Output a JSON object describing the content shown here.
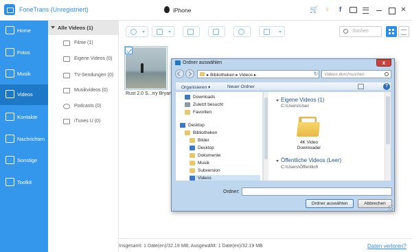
{
  "app": {
    "title": "FoneTrans (Unregistriert)",
    "device": "iPhone",
    "accent": "#2c8ee6"
  },
  "sidebar": {
    "items": [
      {
        "label": "Home",
        "icon": "home-icon"
      },
      {
        "label": "Fotos",
        "icon": "photos-icon"
      },
      {
        "label": "Musik",
        "icon": "music-icon"
      },
      {
        "label": "Videos",
        "icon": "videos-icon",
        "active": true
      },
      {
        "label": "Kontakte",
        "icon": "contacts-icon"
      },
      {
        "label": "Nachrichten",
        "icon": "messages-icon"
      },
      {
        "label": "Sonstige",
        "icon": "other-icon"
      },
      {
        "label": "Toolkit",
        "icon": "toolkit-icon"
      }
    ]
  },
  "categories": {
    "header": "Alle Videos (1)",
    "items": [
      {
        "label": "Filme (1)"
      },
      {
        "label": "Eigene Videos (0)"
      },
      {
        "label": "TV-Sendungen (0)"
      },
      {
        "label": "Musikvideos (0)"
      },
      {
        "label": "Podcasts (0)"
      },
      {
        "label": "iTunes U (0)"
      }
    ]
  },
  "toolbar": {
    "search_placeholder": "Suchen"
  },
  "content": {
    "video_title": "Rust 2.0 S...rry Bryant"
  },
  "status": {
    "text": "Insgesamt: 1 Date(en)/32.19 MB; Ausgewählt: 1 Date(en)/32.19 MB",
    "link": "Daten verloren?"
  },
  "dialog": {
    "title": "Ordner auswählen",
    "close": "x",
    "path": "▸ Bibliotheken ▸ Videos ▸",
    "search_placeholder": "Videos durchsuchen",
    "organize": "Organisieren ▾",
    "new_folder": "Neuer Ordner",
    "help": "?",
    "tree": [
      {
        "label": "Downloads"
      },
      {
        "label": "Zuletzt besucht"
      },
      {
        "label": "Favoriten"
      },
      {
        "label": "Desktop"
      },
      {
        "label": "Bibliotheken"
      },
      {
        "label": "Bilder"
      },
      {
        "label": "Desktop"
      },
      {
        "label": "Dokumente"
      },
      {
        "label": "Musik"
      },
      {
        "label": "Subversion"
      },
      {
        "label": "Videos"
      }
    ],
    "groups": [
      {
        "title": "Eigene Videos (1)",
        "path": "C:\\Users\\User"
      },
      {
        "title": "Öffentliche Videos (Leer)",
        "path": "C:\\Users\\Öffentlich"
      }
    ],
    "folder_item": "4K Video Downloader",
    "folder_label": "Ordner:",
    "folder_value": "",
    "select_button": "Ordner auswählen",
    "cancel_button": "Abbrechen"
  }
}
